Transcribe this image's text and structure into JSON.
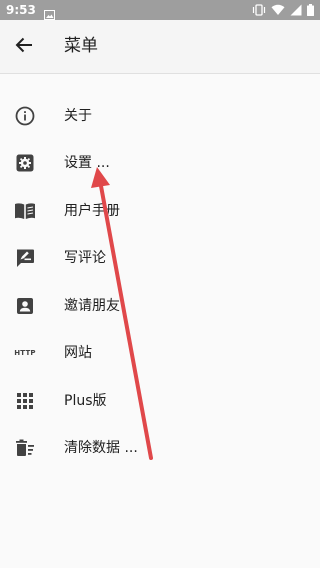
{
  "status_bar": {
    "time": "9:53",
    "icons": [
      "image-icon",
      "vibrate-icon",
      "wifi-icon",
      "signal-icon",
      "battery-icon"
    ]
  },
  "toolbar": {
    "title": "菜单",
    "back_icon": "arrow-back-icon"
  },
  "menu": {
    "items": [
      {
        "label": "关于",
        "icon": "info-icon"
      },
      {
        "label": "设置 ...",
        "icon": "settings-icon"
      },
      {
        "label": "用户手册",
        "icon": "book-icon"
      },
      {
        "label": "写评论",
        "icon": "rate-review-icon"
      },
      {
        "label": "邀请朋友",
        "icon": "contact-card-icon"
      },
      {
        "label": "网站",
        "icon": "http-icon",
        "icon_text": "HTTP"
      },
      {
        "label": "Plus版",
        "icon": "apps-grid-icon"
      },
      {
        "label": "清除数据 ...",
        "icon": "delete-sweep-icon"
      }
    ]
  },
  "annotation": {
    "arrow_color": "#e0484a"
  }
}
